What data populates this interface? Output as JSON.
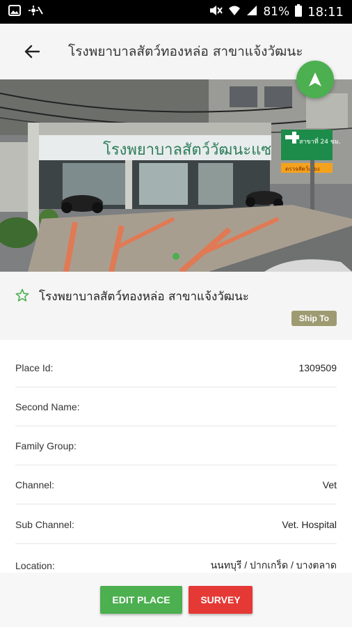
{
  "status_bar": {
    "battery": "81%",
    "time": "18:11"
  },
  "app_bar": {
    "title": "โรงพยาบาลสัตว์ทองหล่อ สาขาแจ้งวัฒนะ"
  },
  "photo": {
    "shop_sign": "โรงพยาบาลสัตว์วัฒนะแซ",
    "side_sign": "สาขาที่ 24 ชม.",
    "side_sign_sub": "ตรวจสัตว์เลี้ยง"
  },
  "place": {
    "name": "โรงพยาบาลสัตว์ทองหล่อ สาขาแจ้งวัฒนะ",
    "badge": "Ship To"
  },
  "details": [
    {
      "label": "Place Id:",
      "value": "1309509"
    },
    {
      "label": "Second Name:",
      "value": ""
    },
    {
      "label": "Family Group:",
      "value": ""
    },
    {
      "label": "Channel:",
      "value": "Vet"
    },
    {
      "label": "Sub Channel:",
      "value": "Vet. Hospital"
    },
    {
      "label": "Location:",
      "value": "นนทบุรี / ปากเกร็ด / บางตลาด"
    }
  ],
  "buttons": {
    "edit": "EDIT PLACE",
    "survey": "SURVEY"
  },
  "colors": {
    "accent_green": "#4caf50",
    "survey_red": "#e53935",
    "badge": "#9e9b72"
  }
}
